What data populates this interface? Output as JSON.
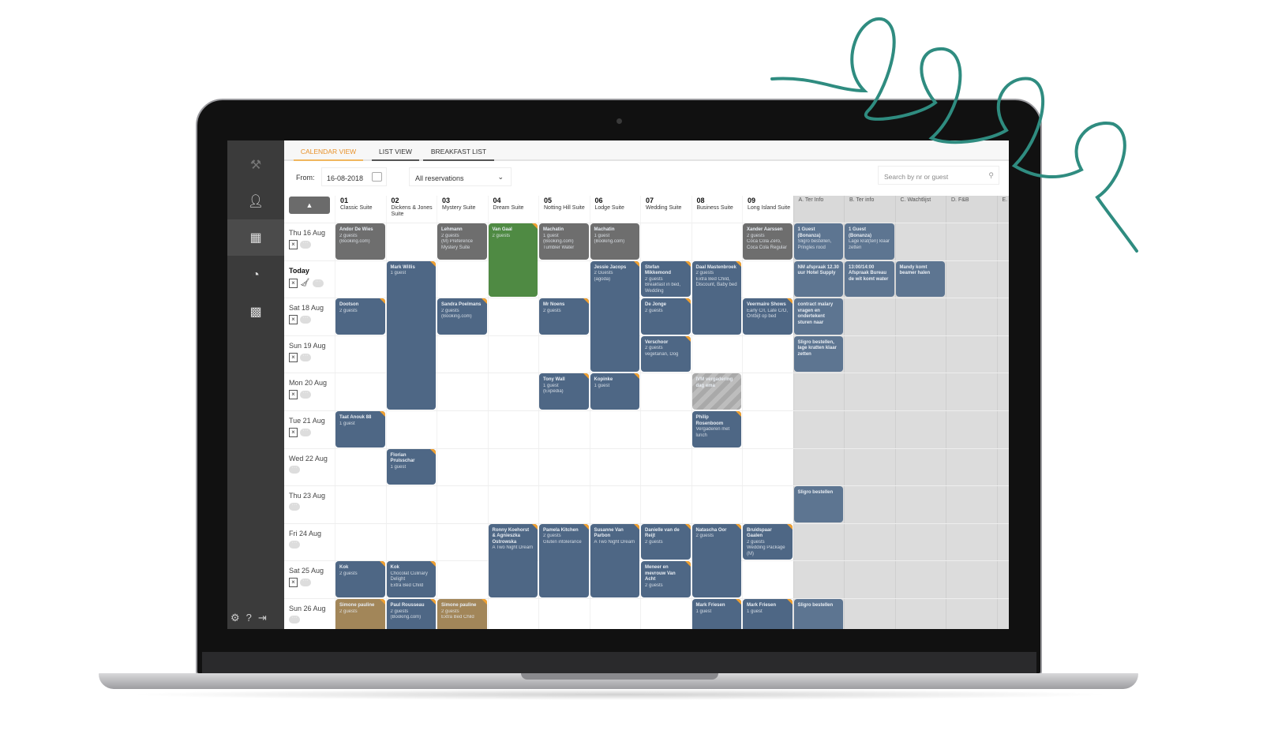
{
  "colors": {
    "blue": "#4e6785",
    "gray": "#6e6e6e",
    "green": "#4f8a43",
    "tan": "#a28659",
    "accent": "#e8922b",
    "squiggle": "#2f8c80",
    "light": "#5d7591"
  },
  "sidebar": {
    "items": [
      {
        "icon": "hammer-icon"
      },
      {
        "icon": "user-icon"
      },
      {
        "icon": "calendar-icon",
        "active": true
      },
      {
        "icon": "pie-chart-icon"
      },
      {
        "icon": "grid-calendar-icon"
      }
    ],
    "bottom": [
      "gear-icon",
      "help-icon",
      "logout-icon"
    ]
  },
  "tabs": [
    {
      "label": "CALENDAR VIEW",
      "active": true
    },
    {
      "label": "LIST VIEW"
    },
    {
      "label": "BREAKFAST LIST"
    }
  ],
  "toolbar": {
    "from_label": "From:",
    "from_value": "16-08-2018",
    "filter_value": "All reservations",
    "search_placeholder": "Search by nr or guest"
  },
  "columns": [
    {
      "nr": "01",
      "name": "Classic Suite"
    },
    {
      "nr": "02",
      "name": "Dickens & Jones Suite"
    },
    {
      "nr": "03",
      "name": "Mystery Suite"
    },
    {
      "nr": "04",
      "name": "Dream Suite"
    },
    {
      "nr": "05",
      "name": "Notting Hill Suite"
    },
    {
      "nr": "06",
      "name": "Lodge Suite"
    },
    {
      "nr": "07",
      "name": "Wedding Suite"
    },
    {
      "nr": "08",
      "name": "Business Suite"
    },
    {
      "nr": "09",
      "name": "Long Island Suite"
    },
    {
      "name": "A. Ter Info",
      "info": true
    },
    {
      "name": "B. Ter info",
      "info": true
    },
    {
      "name": "C. Wachtlijst",
      "info": true
    },
    {
      "name": "D. F&B",
      "info": true
    },
    {
      "name": "E.",
      "info": true
    }
  ],
  "days": [
    {
      "label": "Thu 16 Aug",
      "clip": true
    },
    {
      "label": "Today",
      "clip": true,
      "today": true,
      "broom": true
    },
    {
      "label": "Sat 18 Aug",
      "clip": true
    },
    {
      "label": "Sun 19 Aug",
      "clip": true
    },
    {
      "label": "Mon 20 Aug",
      "clip": true
    },
    {
      "label": "Tue 21 Aug",
      "clip": true
    },
    {
      "label": "Wed 22 Aug"
    },
    {
      "label": "Thu 23 Aug"
    },
    {
      "label": "Fri 24 Aug"
    },
    {
      "label": "Sat 25 Aug",
      "clip": true
    },
    {
      "label": "Sun 26 Aug"
    }
  ],
  "bookings": [
    {
      "col": 0,
      "row": 0,
      "span": 1,
      "color": "gray",
      "lines": [
        "Andor De Wies",
        "2 guests",
        "(Booking.com)"
      ]
    },
    {
      "col": 2,
      "row": 0,
      "span": 1,
      "color": "gray",
      "lines": [
        "Lehmann",
        "2 guests",
        "(M) Preference Mystery Suite"
      ]
    },
    {
      "col": 3,
      "row": 0,
      "span": 2,
      "color": "green",
      "flag": true,
      "lines": [
        "Van Gaal",
        "2 guests"
      ]
    },
    {
      "col": 4,
      "row": 0,
      "span": 1,
      "color": "gray",
      "lines": [
        "Machatin",
        "1 guest",
        "(Booking.com)",
        "Tumbler Water"
      ]
    },
    {
      "col": 5,
      "row": 0,
      "span": 1,
      "color": "gray",
      "lines": [
        "Machatin",
        "1 guest",
        "(Booking.com)"
      ]
    },
    {
      "col": 8,
      "row": 0,
      "span": 1,
      "color": "gray",
      "lines": [
        "Xander Aarssen",
        "2 guests",
        "Coca Cola Zero, Coca Cola Regular"
      ]
    },
    {
      "col": 9,
      "row": 0,
      "span": 1,
      "color": "light",
      "lines": [
        "1 Guest (Bonanza)",
        "Sligro bestellen, Pringles rood"
      ]
    },
    {
      "col": 10,
      "row": 0,
      "span": 1,
      "color": "light",
      "lines": [
        "1 Guest (Bonanza)",
        "Lage krat(ten) klaar zetten"
      ]
    },
    {
      "col": 1,
      "row": 1,
      "span": 4,
      "color": "blue",
      "flag": true,
      "lines": [
        "Mark Willis",
        "1 guest"
      ]
    },
    {
      "col": 5,
      "row": 1,
      "span": 3,
      "color": "blue",
      "flag": true,
      "lines": [
        "Jessie Jacops",
        "2 Guests",
        "(agoda)"
      ]
    },
    {
      "col": 6,
      "row": 1,
      "span": 1,
      "color": "blue",
      "flag": true,
      "lines": [
        "Stefan Mikkemond",
        "2 guests",
        "Breakfast in bed, Wedding"
      ]
    },
    {
      "col": 7,
      "row": 1,
      "span": 2,
      "color": "blue",
      "flag": true,
      "lines": [
        "Daal Mastenbroek",
        "2 guests",
        "Extra Bed Child, Discount, Baby bed"
      ]
    },
    {
      "col": 9,
      "row": 1,
      "span": 1,
      "color": "light",
      "lines": [
        "NM afspraak 12.30 uur Hotel Supply"
      ]
    },
    {
      "col": 10,
      "row": 1,
      "span": 1,
      "color": "light",
      "lines": [
        "13:00/14:00 Afspraak Bureau de wit komt water"
      ]
    },
    {
      "col": 11,
      "row": 1,
      "span": 1,
      "color": "light",
      "lines": [
        "Mandy komt beamer halen"
      ]
    },
    {
      "col": 0,
      "row": 2,
      "span": 1,
      "color": "blue",
      "flag": true,
      "lines": [
        "Dootson",
        "2 guests"
      ]
    },
    {
      "col": 2,
      "row": 2,
      "span": 1,
      "color": "blue",
      "flag": true,
      "lines": [
        "Sandra Poelmans",
        "2 guests",
        "(Booking.com)"
      ]
    },
    {
      "col": 4,
      "row": 2,
      "span": 1,
      "color": "blue",
      "flag": true,
      "lines": [
        "Mr Noens",
        "2 guests"
      ]
    },
    {
      "col": 6,
      "row": 2,
      "span": 1,
      "color": "blue",
      "flag": true,
      "lines": [
        "De Jonge",
        "2 guests"
      ]
    },
    {
      "col": 8,
      "row": 2,
      "span": 1,
      "color": "blue",
      "flag": true,
      "lines": [
        "Veermaire Shows",
        "Early C/I, Late C/O, Ontbijt op bed"
      ]
    },
    {
      "col": 9,
      "row": 2,
      "span": 1,
      "color": "light",
      "lines": [
        "contract malary vragen en ondertekent sturen naar"
      ]
    },
    {
      "col": 6,
      "row": 3,
      "span": 1,
      "color": "blue",
      "flag": true,
      "lines": [
        "Verschoor",
        "2 guests",
        "vegetarian, Dog"
      ]
    },
    {
      "col": 9,
      "row": 3,
      "span": 1,
      "color": "light",
      "lines": [
        "Sligro bestellen, lage kratten klaar zetten"
      ]
    },
    {
      "col": 4,
      "row": 4,
      "span": 1,
      "color": "blue",
      "flag": true,
      "lines": [
        "Tony Wall",
        "1 guest",
        "(Expedia)"
      ]
    },
    {
      "col": 5,
      "row": 4,
      "span": 1,
      "color": "blue",
      "flag": true,
      "lines": [
        "Kopinke",
        "1 guest"
      ]
    },
    {
      "col": 7,
      "row": 4,
      "span": 1,
      "color": "striped",
      "lines": [
        "IVM vergadering dag ema"
      ]
    },
    {
      "col": 0,
      "row": 5,
      "span": 1,
      "color": "blue",
      "flag": true,
      "lines": [
        "Taat Anouk 88",
        "1 guest"
      ]
    },
    {
      "col": 7,
      "row": 5,
      "span": 1,
      "color": "blue",
      "flag": true,
      "lines": [
        "Philip Rosenboom",
        "Vergaderen met lunch"
      ]
    },
    {
      "col": 1,
      "row": 6,
      "span": 1,
      "color": "blue",
      "flag": true,
      "lines": [
        "Florian Pruisschar",
        "1 guest"
      ]
    },
    {
      "col": 9,
      "row": 7,
      "span": 1,
      "color": "light",
      "lines": [
        "Sligro bestellen"
      ]
    },
    {
      "col": 3,
      "row": 8,
      "span": 2,
      "color": "blue",
      "flag": true,
      "lines": [
        "Ronny Koehorst & Agnieszka Ostrowska",
        "A Two Night Dream"
      ]
    },
    {
      "col": 4,
      "row": 8,
      "span": 2,
      "color": "blue",
      "flag": true,
      "lines": [
        "Pamela Kitchen",
        "2 guests",
        "Gluten intolerance"
      ]
    },
    {
      "col": 5,
      "row": 8,
      "span": 2,
      "color": "blue",
      "flag": true,
      "lines": [
        "Susanne Van Parbon",
        "A Two Night Dream"
      ]
    },
    {
      "col": 6,
      "row": 8,
      "span": 1,
      "color": "blue",
      "flag": true,
      "lines": [
        "Danielle van de Reijt",
        "2 guests"
      ]
    },
    {
      "col": 7,
      "row": 8,
      "span": 2,
      "color": "blue",
      "flag": true,
      "lines": [
        "Natascha Oor",
        "2 guests"
      ]
    },
    {
      "col": 8,
      "row": 8,
      "span": 1,
      "color": "blue",
      "flag": true,
      "lines": [
        "Bruidspaar Gaalen",
        "2 guests",
        "Wedding Package (M)"
      ]
    },
    {
      "col": 0,
      "row": 9,
      "span": 1,
      "color": "blue",
      "flag": true,
      "lines": [
        "Kok",
        "2 guests"
      ]
    },
    {
      "col": 1,
      "row": 9,
      "span": 1,
      "color": "blue",
      "flag": true,
      "lines": [
        "Kok",
        "Chocolat Culinary Delight",
        "Extra Bed Child"
      ]
    },
    {
      "col": 6,
      "row": 9,
      "span": 1,
      "color": "blue",
      "flag": true,
      "lines": [
        "Meneer en mevrouw Van Acht",
        "2 guests"
      ]
    },
    {
      "col": 0,
      "row": 10,
      "span": 1,
      "color": "tan",
      "flag": true,
      "lines": [
        "Simone pauline",
        "2 guests"
      ]
    },
    {
      "col": 1,
      "row": 10,
      "span": 1,
      "color": "blue",
      "flag": true,
      "lines": [
        "Paul Rousseau",
        "2 guests",
        "(Booking.com)"
      ]
    },
    {
      "col": 2,
      "row": 10,
      "span": 1,
      "color": "tan",
      "flag": true,
      "lines": [
        "Simone pauline",
        "2 guests",
        "Extra Bed Child"
      ]
    },
    {
      "col": 7,
      "row": 10,
      "span": 1,
      "color": "blue",
      "flag": true,
      "lines": [
        "Mark Friesen",
        "1 guest"
      ]
    },
    {
      "col": 8,
      "row": 10,
      "span": 1,
      "color": "blue",
      "flag": true,
      "lines": [
        "Mark Friesen",
        "1 guest"
      ]
    },
    {
      "col": 9,
      "row": 10,
      "span": 1,
      "color": "light",
      "lines": [
        "Sligro bestellen"
      ]
    }
  ]
}
